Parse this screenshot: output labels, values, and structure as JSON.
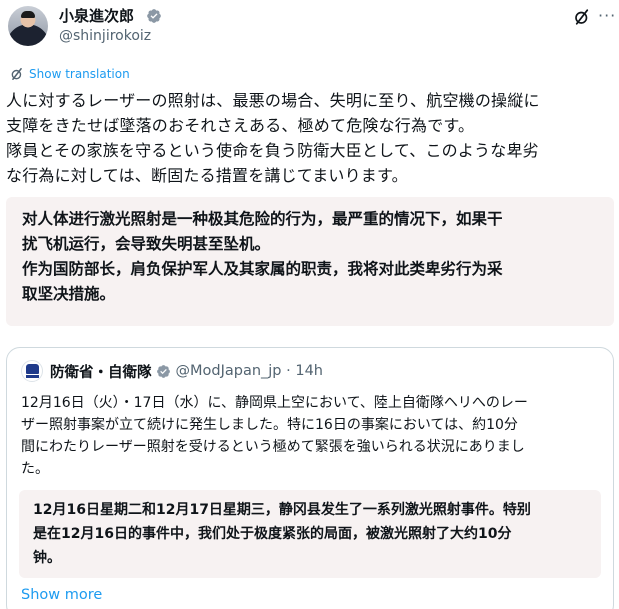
{
  "author": {
    "display_name": "小泉進次郎",
    "handle": "@shinjirokoiz"
  },
  "translate": {
    "label": "Show translation"
  },
  "post": {
    "ja_lines": [
      "人に対するレーザーの照射は、最悪の場合、失明に至り、航空機の操縦に",
      "支障をきたせば墜落のおそれさえある、極めて危険な行為です。",
      "隊員とその家族を守るという使命を負う防衛大臣として、このような卑劣",
      "な行為に対しては、断固たる措置を講じてまいります。"
    ],
    "zh_lines": [
      "对人体进行激光照射是一种极其危险的行为，最严重的情况下，如果干",
      "扰飞机运行，会导致失明甚至坠机。",
      "作为国防部长，肩负保护军人及其家属的职责，我将对此类卑劣行为采",
      "取坚决措施。"
    ]
  },
  "quote": {
    "name": "防衛省・自衛隊",
    "handle_time": "@ModJapan_jp · 14h",
    "ja_lines": [
      "12月16日（火）・17日（水）に、静岡県上空において、陸上自衛隊ヘリへのレー",
      "ザー照射事案が立て続けに発生しました。特に16日の事案においては、約10分",
      "間にわたりレーザー照射を受けるという極めて緊張を強いられる状況にありまし",
      "た。"
    ],
    "zh_lines": [
      "12月16日星期二和12月17日星期三，静冈县发生了一系列激光照射事件。特别",
      "是在12月16日的事件中，我们处于极度紧张的局面，被激光照射了大约10分",
      "钟。"
    ],
    "show_more": "Show more"
  },
  "colors": {
    "link": "#1d9bf0",
    "verified": "#8b98a5",
    "translation_bg": "#f7f2f2"
  },
  "icons": [
    "avatar",
    "verified-badge-icon",
    "grok-icon",
    "more-icon",
    "translate-icon"
  ]
}
